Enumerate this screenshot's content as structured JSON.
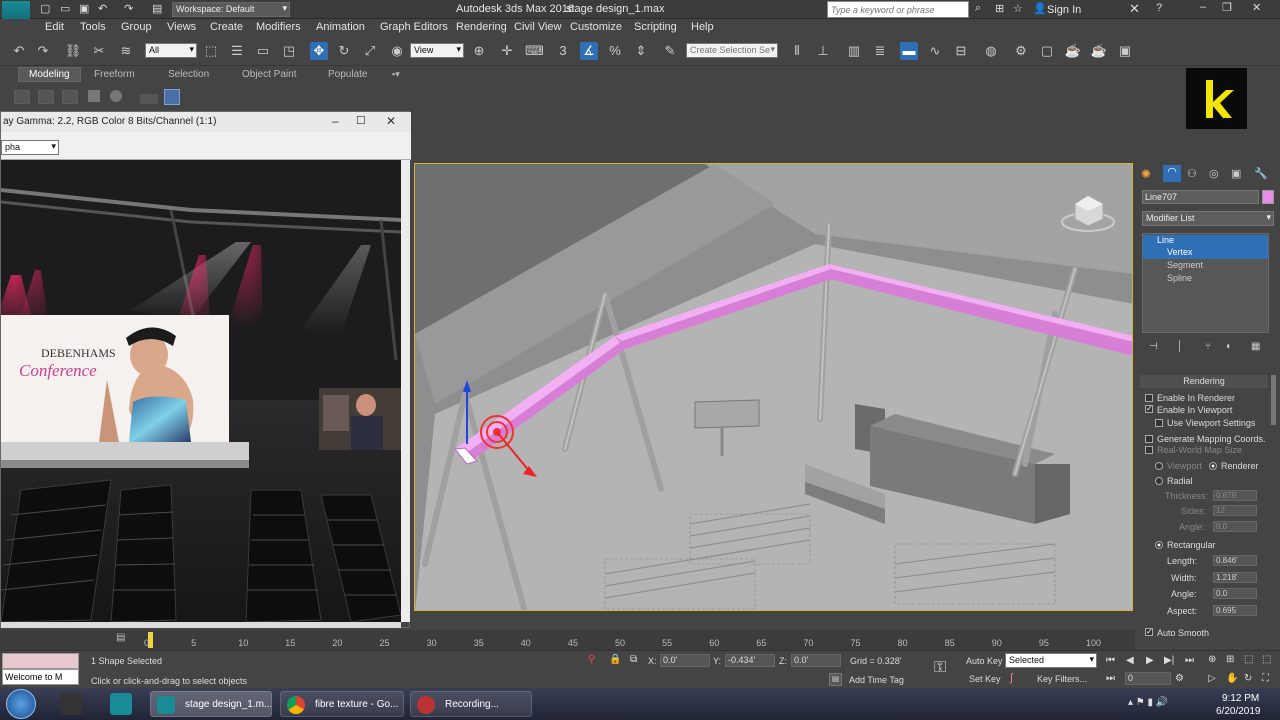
{
  "titlebar": {
    "workspace": "Workspace: Default",
    "app_title": "Autodesk 3ds Max 2016",
    "file_title": "stage design_1.max",
    "search_placeholder": "Type a keyword or phrase",
    "sign_in": "Sign In",
    "app_badge": "MAX"
  },
  "menu": [
    "Edit",
    "Tools",
    "Group",
    "Views",
    "Create",
    "Modifiers",
    "Animation",
    "Graph Editors",
    "Rendering",
    "Civil View",
    "Customize",
    "Scripting",
    "Help"
  ],
  "toolbar": {
    "filter": "All",
    "ref_coord": "View",
    "selection_set_placeholder": "Create Selection Se"
  },
  "ribbon": {
    "tabs": [
      "Modeling",
      "Freeform",
      "Selection",
      "Object Paint",
      "Populate"
    ]
  },
  "vfb": {
    "title": "ay Gamma: 2.2, RGB Color 8 Bits/Channel (1:1)",
    "channel": "pha",
    "banner_title": "DEBENHAMS",
    "banner_script": "Conference"
  },
  "brand_logo": "k",
  "cmdpanel": {
    "object_name": "Line707",
    "modifier_list": "Modifier List",
    "stack": [
      "Line",
      "Vertex",
      "Segment",
      "Spline"
    ],
    "rollout": "Rendering",
    "enable_in_renderer": "Enable In Renderer",
    "enable_in_viewport": "Enable In Viewport",
    "use_viewport_settings": "Use Viewport Settings",
    "generate_mapping": "Generate Mapping Coords.",
    "real_world": "Real-World Map Size",
    "viewport": "Viewport",
    "renderer": "Renderer",
    "radial": "Radial",
    "thickness_label": "Thickness:",
    "thickness": "0.679'",
    "sides_label": "Sides:",
    "sides": "12",
    "angle_label": "Angle:",
    "angle_radial": "0.0",
    "rectangular": "Rectangular",
    "length_label": "Length:",
    "length": "0.846'",
    "width_label": "Width:",
    "width": "1.218'",
    "angle_rect": "0.0",
    "aspect_label": "Aspect:",
    "aspect": "0.695",
    "auto_smooth": "Auto Smooth"
  },
  "timeline": {
    "ticks": [
      "0",
      "5",
      "10",
      "15",
      "20",
      "25",
      "30",
      "35",
      "40",
      "45",
      "50",
      "55",
      "60",
      "65",
      "70",
      "75",
      "80",
      "85",
      "90",
      "95",
      "100"
    ],
    "frame_position": 0
  },
  "status": {
    "maxscript": "Welcome to M",
    "selected": "1 Shape Selected",
    "prompt": "Click or click-and-drag to select objects",
    "x_label": "X:",
    "x": "0.0'",
    "y_label": "Y:",
    "y": "-0.434'",
    "z_label": "Z:",
    "z": "0.0'",
    "grid": "Grid = 0.328'",
    "add_time_tag": "Add Time Tag",
    "auto_key": "Auto Key",
    "set_key": "Set Key",
    "key_mode": "Selected",
    "key_filters": "Key Filters...",
    "frame": "0"
  },
  "taskbar": {
    "tasks": [
      "stage design_1.m...",
      "fibre texture - Go...",
      "Recording..."
    ],
    "time": "9:12 PM",
    "date": "6/20/2019"
  },
  "colors": {
    "accent": "#2f6fb5",
    "spline": "#e88ee8"
  }
}
